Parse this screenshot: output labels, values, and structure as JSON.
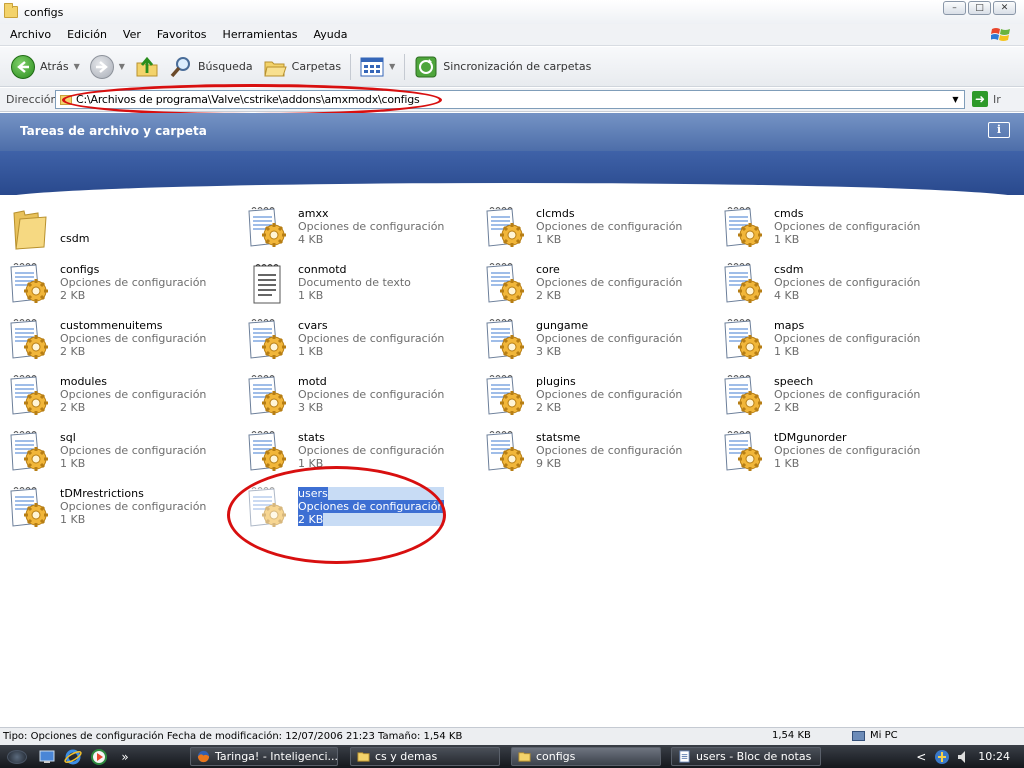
{
  "window": {
    "title": "configs",
    "controls": [
      "minimize",
      "maximize",
      "close"
    ]
  },
  "menu": [
    "Archivo",
    "Edición",
    "Ver",
    "Favoritos",
    "Herramientas",
    "Ayuda"
  ],
  "toolbar": {
    "back_label": "Atrás",
    "search_label": "Búsqueda",
    "folders_label": "Carpetas",
    "sync_label": "Sincronización de carpetas"
  },
  "address": {
    "label": "Dirección",
    "path": "C:\\Archivos de programa\\Valve\\cstrike\\addons\\amxmodx\\configs",
    "go_label": "Ir"
  },
  "taskpane": {
    "title": "Tareas de archivo y carpeta",
    "info_glyph": "i"
  },
  "files": [
    {
      "name": "csdm",
      "type": "",
      "size": "",
      "icon": "folder-icon",
      "col": 0,
      "row": 0
    },
    {
      "name": "amxx",
      "type": "Opciones de configuración",
      "size": "4 KB",
      "icon": "config-file-icon",
      "col": 1,
      "row": 0
    },
    {
      "name": "clcmds",
      "type": "Opciones de configuración",
      "size": "1 KB",
      "icon": "config-file-icon",
      "col": 2,
      "row": 0
    },
    {
      "name": "cmds",
      "type": "Opciones de configuración",
      "size": "1 KB",
      "icon": "config-file-icon",
      "col": 3,
      "row": 0
    },
    {
      "name": "configs",
      "type": "Opciones de configuración",
      "size": "2 KB",
      "icon": "config-file-icon",
      "col": 0,
      "row": 1
    },
    {
      "name": "conmotd",
      "type": "Documento de texto",
      "size": "1 KB",
      "icon": "text-file-icon",
      "col": 1,
      "row": 1
    },
    {
      "name": "core",
      "type": "Opciones de configuración",
      "size": "2 KB",
      "icon": "config-file-icon",
      "col": 2,
      "row": 1
    },
    {
      "name": "csdm",
      "type": "Opciones de configuración",
      "size": "4 KB",
      "icon": "config-file-icon",
      "col": 3,
      "row": 1
    },
    {
      "name": "custommenuitems",
      "type": "Opciones de configuración",
      "size": "2 KB",
      "icon": "config-file-icon",
      "col": 0,
      "row": 2
    },
    {
      "name": "cvars",
      "type": "Opciones de configuración",
      "size": "1 KB",
      "icon": "config-file-icon",
      "col": 1,
      "row": 2
    },
    {
      "name": "gungame",
      "type": "Opciones de configuración",
      "size": "3 KB",
      "icon": "config-file-icon",
      "col": 2,
      "row": 2
    },
    {
      "name": "maps",
      "type": "Opciones de configuración",
      "size": "1 KB",
      "icon": "config-file-icon",
      "col": 3,
      "row": 2
    },
    {
      "name": "modules",
      "type": "Opciones de configuración",
      "size": "2 KB",
      "icon": "config-file-icon",
      "col": 0,
      "row": 3
    },
    {
      "name": "motd",
      "type": "Opciones de configuración",
      "size": "3 KB",
      "icon": "config-file-icon",
      "col": 1,
      "row": 3
    },
    {
      "name": "plugins",
      "type": "Opciones de configuración",
      "size": "2 KB",
      "icon": "config-file-icon",
      "col": 2,
      "row": 3
    },
    {
      "name": "speech",
      "type": "Opciones de configuración",
      "size": "2 KB",
      "icon": "config-file-icon",
      "col": 3,
      "row": 3
    },
    {
      "name": "sql",
      "type": "Opciones de configuración",
      "size": "1 KB",
      "icon": "config-file-icon",
      "col": 0,
      "row": 4
    },
    {
      "name": "stats",
      "type": "Opciones de configuración",
      "size": "1 KB",
      "icon": "config-file-icon",
      "col": 1,
      "row": 4
    },
    {
      "name": "statsme",
      "type": "Opciones de configuración",
      "size": "9 KB",
      "icon": "config-file-icon",
      "col": 2,
      "row": 4
    },
    {
      "name": "tDMgunorder",
      "type": "Opciones de configuración",
      "size": "1 KB",
      "icon": "config-file-icon",
      "col": 3,
      "row": 4
    },
    {
      "name": "tDMrestrictions",
      "type": "Opciones de configuración",
      "size": "1 KB",
      "icon": "config-file-icon",
      "col": 0,
      "row": 5
    },
    {
      "name": "users",
      "type": "Opciones de configuración",
      "size": "2 KB",
      "icon": "config-file-icon",
      "col": 1,
      "row": 5,
      "selected": true
    }
  ],
  "status": {
    "details": "Tipo: Opciones de configuración Fecha de modificación: 12/07/2006 21:23 Tamaño: 1,54 KB",
    "size": "1,54 KB",
    "zone": "Mi PC"
  },
  "taskbar": {
    "overflow": "»",
    "tasks": [
      {
        "label": "Taringa! - Inteligenci...",
        "icon": "firefox-icon"
      },
      {
        "label": "cs y demas",
        "icon": "folder-icon"
      },
      {
        "label": "configs",
        "icon": "folder-icon",
        "active": true
      },
      {
        "label": "users - Bloc de notas",
        "icon": "notepad-icon"
      }
    ],
    "tray_arrow": "<",
    "clock": "10:24"
  },
  "colors": {
    "highlight_circle": "#d80f0f",
    "selection": "#3d6fd3",
    "taskpane": "#4d6ea9"
  }
}
